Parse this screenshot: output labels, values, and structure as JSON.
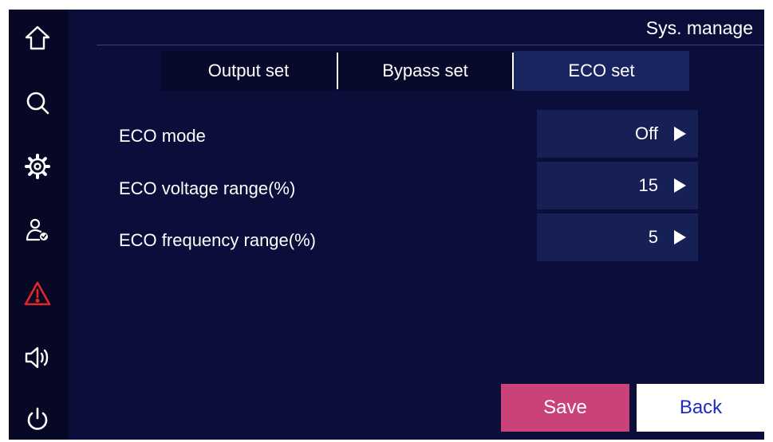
{
  "header": {
    "title": "Sys. manage"
  },
  "sidebar": {
    "items": [
      {
        "icon": "home-icon"
      },
      {
        "icon": "search-icon"
      },
      {
        "icon": "gear-icon"
      },
      {
        "icon": "user-settings-icon"
      },
      {
        "icon": "alarm-warning-icon",
        "color": "#e02828"
      },
      {
        "icon": "speaker-icon"
      },
      {
        "icon": "power-icon"
      }
    ]
  },
  "tabs": [
    {
      "label": "Output set",
      "active": false
    },
    {
      "label": "Bypass set",
      "active": false
    },
    {
      "label": "ECO set",
      "active": true
    }
  ],
  "settings": [
    {
      "label": "ECO mode",
      "value": "Off"
    },
    {
      "label": "ECO voltage range(%)",
      "value": "15"
    },
    {
      "label": "ECO frequency range(%)",
      "value": "5"
    }
  ],
  "buttons": {
    "save": "Save",
    "back": "Back"
  },
  "colors": {
    "background": "#0b0d3a",
    "sidebar": "#060826",
    "active_tab": "#192560",
    "value_box": "#162054",
    "save": "#c9437a",
    "back_text": "#1d2ac4",
    "alarm": "#e02828"
  }
}
